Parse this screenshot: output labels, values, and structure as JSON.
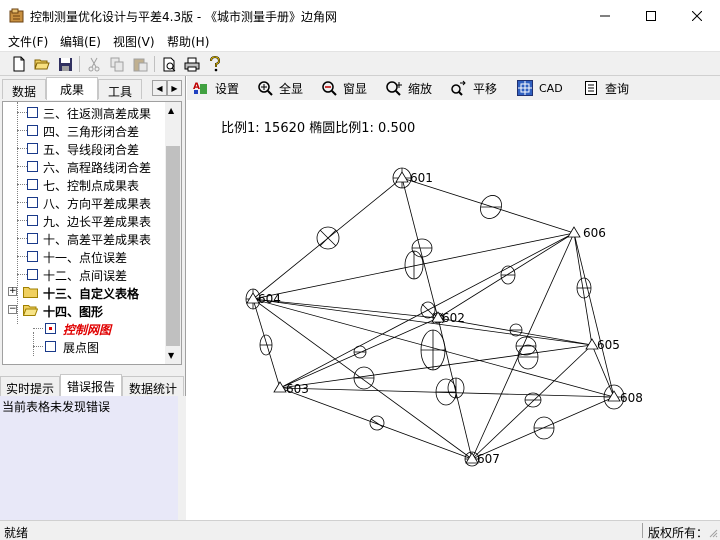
{
  "window": {
    "title": "控制测量优化设计与平差4.3版 - 《城市测量手册》边角网",
    "minimize_icon": "minimize-icon",
    "maximize_icon": "maximize-icon",
    "close_icon": "close-icon"
  },
  "menu": {
    "file": "文件(F)",
    "edit": "编辑(E)",
    "view": "视图(V)",
    "help": "帮助(H)"
  },
  "left_tabs": {
    "data": "数据",
    "results": "成果",
    "tools": "工具"
  },
  "tree": {
    "items": [
      {
        "label": "三、往返测高差成果"
      },
      {
        "label": "四、三角形闭合差"
      },
      {
        "label": "五、导线段闭合差"
      },
      {
        "label": "六、高程路线闭合差"
      },
      {
        "label": "七、控制点成果表"
      },
      {
        "label": "八、方向平差成果表"
      },
      {
        "label": "九、边长平差成果表"
      },
      {
        "label": "十、高差平差成果表"
      },
      {
        "label": "十一、点位误差"
      },
      {
        "label": "十二、点间误差"
      }
    ],
    "folder13": "十三、自定义表格",
    "folder14": "十四、图形",
    "child_active": "控制网图",
    "child_plain": "展点图",
    "active_color": "#e00000"
  },
  "bottom_tabs": {
    "hints": "实时提示",
    "errors": "错误报告",
    "stats": "数据统计"
  },
  "error_message": "当前表格未发现错误",
  "graph_toolbar": {
    "settings": "设置",
    "fit": "全显",
    "window": "窗显",
    "zoom": "缩放",
    "pan": "平移",
    "cad": "CAD",
    "query": "查询"
  },
  "scale_text": "比例1: 15620   椭圆比例1: 0.500",
  "network": {
    "points": [
      {
        "id": "601"
      },
      {
        "id": "602"
      },
      {
        "id": "603"
      },
      {
        "id": "604"
      },
      {
        "id": "605"
      },
      {
        "id": "606"
      },
      {
        "id": "607"
      },
      {
        "id": "608"
      }
    ]
  },
  "status": {
    "left": "就绪",
    "right": "版权所有："
  },
  "icons": {
    "new": "new-file-icon",
    "open": "open-folder-icon",
    "save": "save-icon",
    "cut": "cut-icon",
    "copy": "copy-icon",
    "paste": "paste-icon",
    "preview": "print-preview-icon",
    "print": "print-icon",
    "about": "help-icon"
  }
}
